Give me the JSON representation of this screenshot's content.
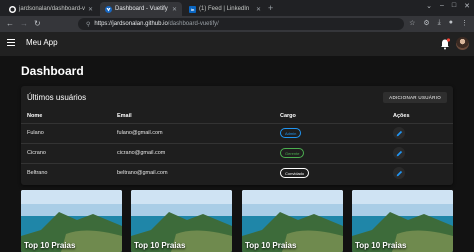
{
  "browser": {
    "tabs": [
      {
        "title": "jardsonalan/dashboard-v",
        "icon": "github-icon",
        "active": false
      },
      {
        "title": "Dashboard - Vuetify",
        "icon": "vuetify-icon",
        "active": true
      },
      {
        "title": "(1) Feed | LinkedIn",
        "icon": "linkedin-icon",
        "active": false
      }
    ],
    "new_tab": "+",
    "url_host": "https://jardsonalan.github.io",
    "url_path": "/dashboard-vuetify/"
  },
  "app": {
    "title": "Meu App"
  },
  "page": {
    "title": "Dashboard"
  },
  "users_card": {
    "title": "Últimos usuários",
    "add_button": "ADICIONAR USUÁRIO",
    "columns": [
      "Nome",
      "Email",
      "Cargo",
      "Ações"
    ],
    "rows": [
      {
        "name": "Fulano",
        "email": "fulano@gmail.com",
        "role": "Admin",
        "role_color": "#2196f3"
      },
      {
        "name": "Cicrano",
        "email": "cicrano@gmail.com",
        "role": "Gerente",
        "role_color": "#4caf50"
      },
      {
        "name": "Beltrano",
        "email": "beltrano@gmail.com",
        "role": "Convidado",
        "role_color": "#ffffff"
      }
    ]
  },
  "image_cards": [
    {
      "caption": "Top 10 Praias"
    },
    {
      "caption": "Top 10 Praias"
    },
    {
      "caption": "Top 10 Praias"
    },
    {
      "caption": "Top 10 Praias"
    }
  ],
  "colors": {
    "background": "#121212",
    "surface": "#1e1e1e",
    "appbar": "#212121",
    "action_icon": "#2196f3"
  }
}
